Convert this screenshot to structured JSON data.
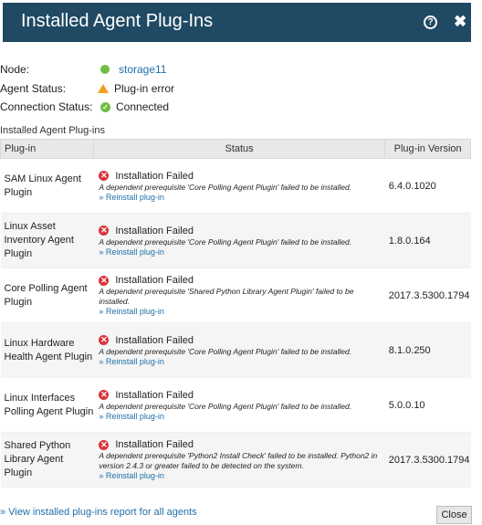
{
  "header": {
    "title": "Installed Agent Plug-Ins",
    "help_icon": "help-circle-icon",
    "close_icon": "close-icon"
  },
  "info": {
    "node_label": "Node:",
    "node_value": "storage11",
    "agent_status_label": "Agent Status:",
    "agent_status_value": "Plug-in error",
    "connection_status_label": "Connection Status:",
    "connection_status_value": "Connected"
  },
  "section_title": "Installed Agent Plug-ins",
  "table": {
    "columns": [
      "Plug-in",
      "Status",
      "Plug-in Version"
    ],
    "rows": [
      {
        "plugin": "SAM Linux Agent Plugin",
        "status": "Installation Failed",
        "message": "A dependent prerequisite 'Core Polling Agent Plugin' failed to be installed.",
        "reinstall": "» Reinstall plug-in",
        "version": "6.4.0.1020"
      },
      {
        "plugin": "Linux Asset Inventory Agent Plugin",
        "status": "Installation Failed",
        "message": "A dependent prerequisite 'Core Polling Agent Plugin' failed to be installed.",
        "reinstall": "» Reinstall plug-in",
        "version": "1.8.0.164"
      },
      {
        "plugin": "Core Polling Agent Plugin",
        "status": "Installation Failed",
        "message": "A dependent prerequisite 'Shared Python Library Agent Plugin' failed to be installed.",
        "reinstall": "» Reinstall plug-in",
        "version": "2017.3.5300.1794"
      },
      {
        "plugin": "Linux Hardware Health Agent Plugin",
        "status": "Installation Failed",
        "message": "A dependent prerequisite 'Core Polling Agent Plugin' failed to be installed.",
        "reinstall": "» Reinstall plug-in",
        "version": "8.1.0.250"
      },
      {
        "plugin": "Linux Interfaces Polling Agent Plugin",
        "status": "Installation Failed",
        "message": "A dependent prerequisite 'Core Polling Agent Plugin' failed to be installed.",
        "reinstall": "» Reinstall plug-in",
        "version": "5.0.0.10"
      },
      {
        "plugin": "Shared Python Library Agent Plugin",
        "status": "Installation Failed",
        "message": "A dependent prerequisite 'Python2 Install Check' failed to be installed. Python2 in version 2.4.3 or greater failed to be detected on the system.",
        "reinstall": "» Reinstall plug-in",
        "version": "2017.3.5300.1794"
      }
    ]
  },
  "footer": {
    "report_link": "» View installed plug-ins report for all agents",
    "close_button": "Close"
  },
  "colors": {
    "header_bg": "#204a63",
    "link": "#1f6fa8",
    "error": "#d9343a",
    "ok": "#6fbf44",
    "warning": "#f0a020"
  }
}
